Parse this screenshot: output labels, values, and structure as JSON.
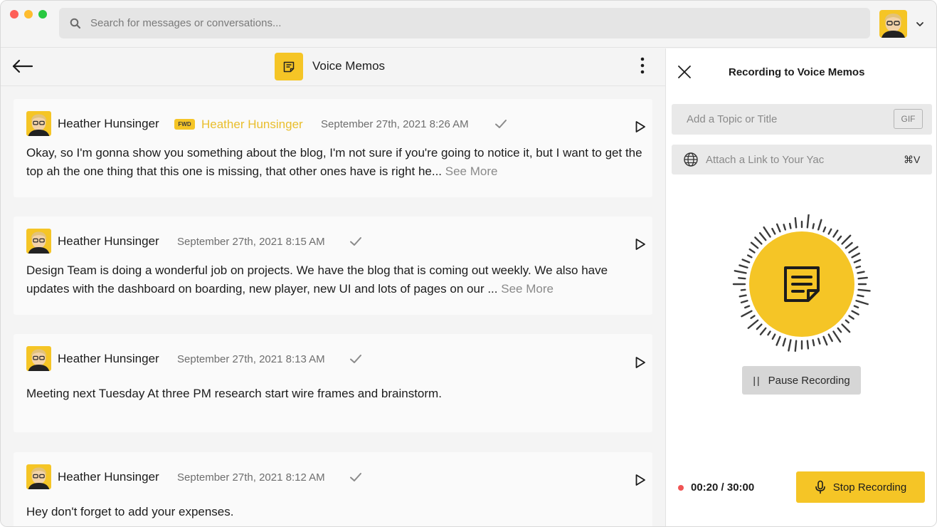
{
  "window": {
    "search": {
      "placeholder": "Search for messages or conversations..."
    }
  },
  "conversation": {
    "title": "Voice Memos",
    "icon": "memo-icon"
  },
  "messages": [
    {
      "author": "Heather Hunsinger",
      "fwd_badge": "FWD",
      "forwarded_from": "Heather Hunsinger",
      "date": "September 27th, 2021 8:26 AM",
      "text": "Okay, so I'm gonna show you something about the blog, I'm not sure if you're going to notice it, but I want to get the top ah the one thing that this one is missing, that other ones have is right he...",
      "see_more": "See More"
    },
    {
      "author": "Heather Hunsinger",
      "date": "September 27th, 2021 8:15 AM",
      "text": "Design Team is doing a wonderful job on projects. We have the blog that is coming out weekly. We also have updates with the dashboard on boarding, new player, new UI and lots of pages on our ...",
      "see_more": "See More"
    },
    {
      "author": "Heather Hunsinger",
      "date": "September 27th, 2021 8:13 AM",
      "text": "Meeting next Tuesday At three PM research start wire frames and brainstorm."
    },
    {
      "author": "Heather Hunsinger",
      "date": "September 27th, 2021 8:12 AM",
      "text": "Hey don't forget to add your expenses."
    }
  ],
  "recorder": {
    "title": "Recording to Voice Memos",
    "topic_placeholder": "Add a Topic or Title",
    "gif_label": "GIF",
    "link_placeholder": "Attach a Link to Your Yac",
    "link_shortcut": "⌘V",
    "pause_label": "Pause Recording",
    "timer": "00:20 / 30:00",
    "stop_label": "Stop Recording"
  },
  "colors": {
    "accent_yellow": "#f5c526",
    "forward_name": "#e9be2c",
    "recording_dot": "#f05454"
  }
}
